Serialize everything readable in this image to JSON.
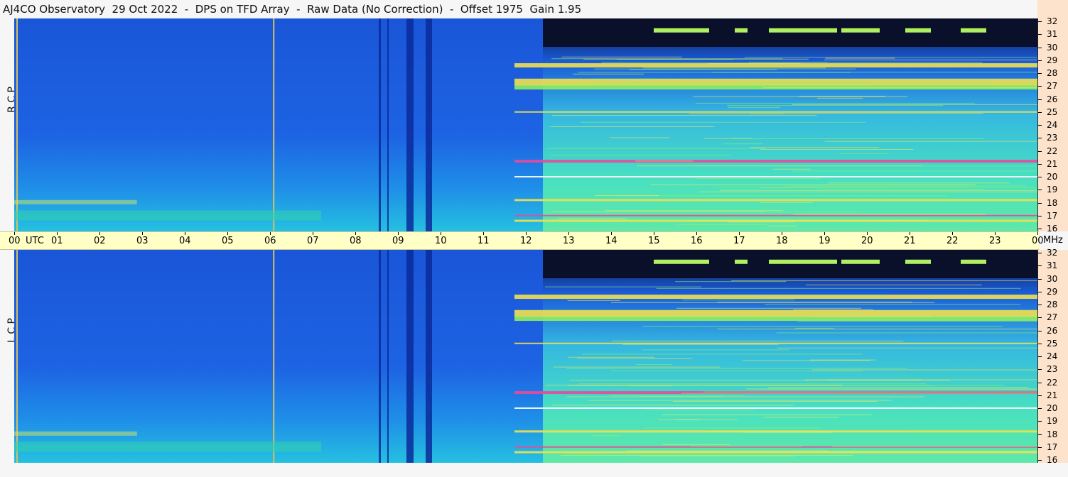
{
  "title": "AJ4CO Observatory  29 Oct 2022  -  DPS on TFD Array  -  Raw Data (No Correction)  -  Offset 1975  Gain 1.95",
  "panels": {
    "top": {
      "label": "R C P"
    },
    "bottom": {
      "label": "L C P"
    }
  },
  "time_axis": {
    "unit_label": "UTC",
    "ticks": [
      "00",
      "01",
      "02",
      "03",
      "04",
      "05",
      "06",
      "07",
      "08",
      "09",
      "10",
      "11",
      "12",
      "13",
      "14",
      "15",
      "16",
      "17",
      "18",
      "19",
      "20",
      "21",
      "22",
      "23",
      "00"
    ]
  },
  "freq_axis": {
    "unit_label": "MHz",
    "ticks": [
      "32",
      "31",
      "30",
      "29",
      "28",
      "27",
      "26",
      "25",
      "24",
      "23",
      "22",
      "21",
      "20",
      "19",
      "18",
      "17",
      "16"
    ]
  },
  "colors": {
    "background_quiet": "#1f5fe0",
    "background_active": "#3fd8c8",
    "dark_sky": "#0a0f2a",
    "band_hot": "#e84a9a",
    "band_warm": "#f0e050",
    "time_axis_bg": "#ffffc6",
    "freq_axis_bg": "#fde3cc"
  }
}
